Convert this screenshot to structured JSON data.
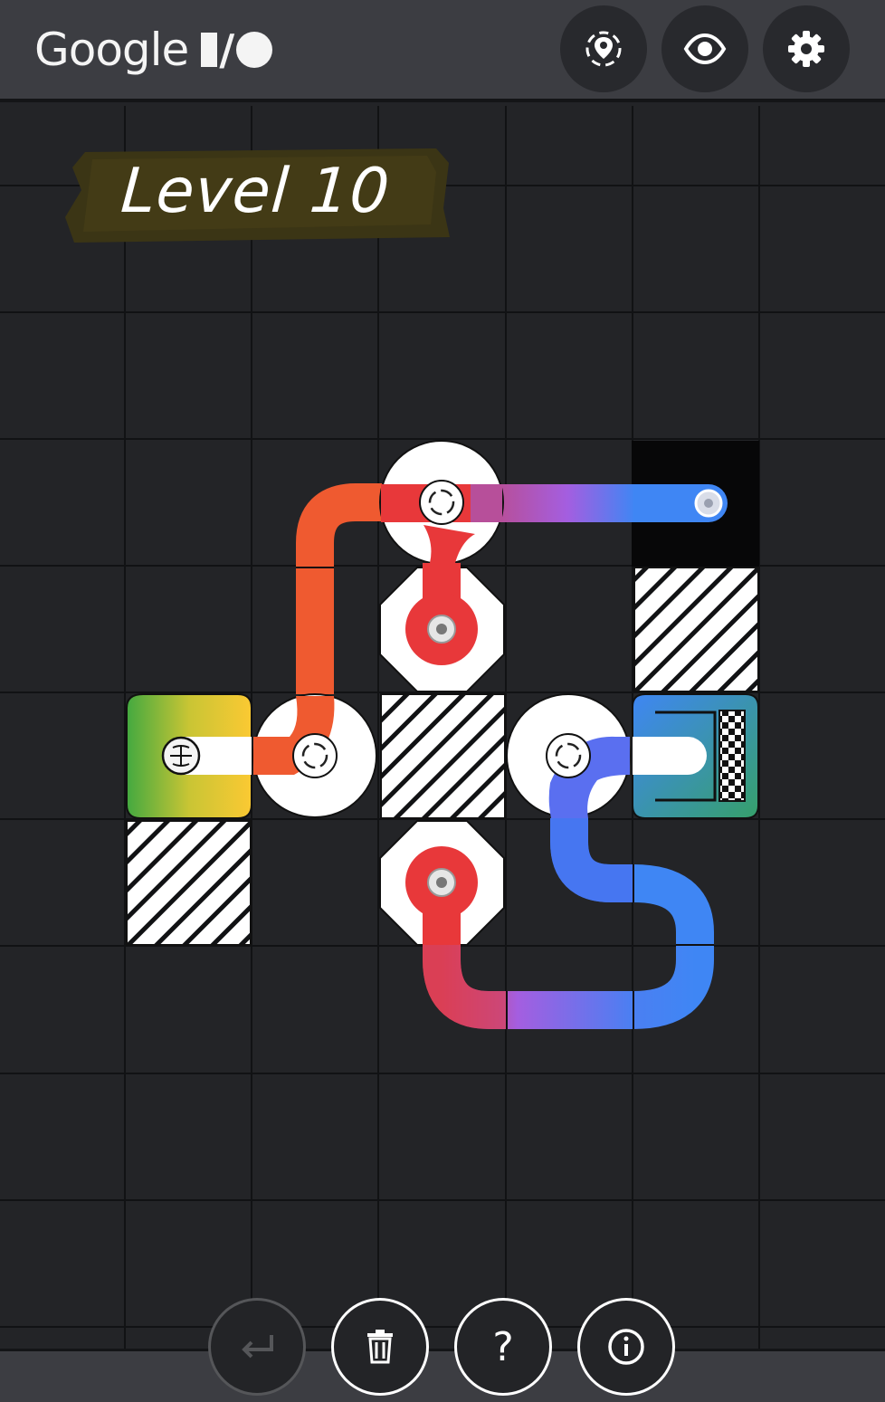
{
  "header": {
    "logo_text": "Google",
    "buttons": [
      {
        "name": "location-button",
        "icon": "location-pin-icon"
      },
      {
        "name": "view-button",
        "icon": "eye-icon"
      },
      {
        "name": "settings-button",
        "icon": "gear-icon"
      }
    ]
  },
  "level": {
    "label": "Level 10"
  },
  "toolbar": {
    "undo": {
      "icon": "undo-arrow-icon",
      "enabled": false
    },
    "delete": {
      "icon": "trash-icon",
      "enabled": true
    },
    "help": {
      "icon": "question-mark-icon",
      "label": "?",
      "enabled": true
    },
    "info": {
      "icon": "info-icon",
      "enabled": true
    }
  },
  "colors": {
    "background": "#232427",
    "header": "#3c3d42",
    "grid_line": "#111214",
    "track_red": "#e8383a",
    "track_orange": "#ef5a30",
    "track_purple": "#a45ee0",
    "track_blue": "#3f86f4",
    "start_green": "#43a940",
    "start_yellow": "#fbc933"
  }
}
